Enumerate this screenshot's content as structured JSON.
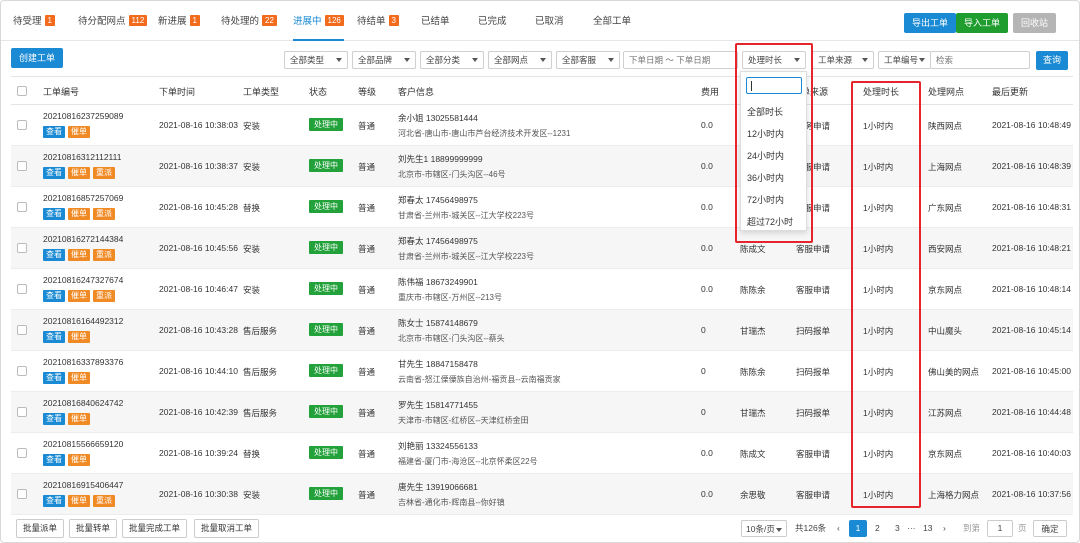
{
  "tabs": [
    {
      "label": "待受理",
      "count": "1"
    },
    {
      "label": "待分配网点",
      "count": "112"
    },
    {
      "label": "新进展",
      "count": "1"
    },
    {
      "label": "待处理的",
      "count": "22"
    },
    {
      "label": "进展中",
      "count": "126",
      "active": true
    },
    {
      "label": "待结单",
      "count": "3"
    },
    {
      "label": "已结单",
      "count": ""
    },
    {
      "label": "已完成",
      "count": ""
    },
    {
      "label": "已取消",
      "count": ""
    },
    {
      "label": "全部工单",
      "count": ""
    }
  ],
  "top_buttons": {
    "export": "导出工单",
    "import": "导入工单",
    "recycle": "回收站"
  },
  "toolbar": {
    "create": "创建工单",
    "filters": [
      "全部类型",
      "全部品牌",
      "全部分类",
      "全部网点",
      "全部客服"
    ],
    "date_placeholder": "下单日期 ～ 下单日期",
    "duration_select": "处理时长",
    "source_select": "工单来源",
    "number_select": "工单编号",
    "search_placeholder": "检索",
    "search_button": "查询"
  },
  "columns": [
    "工单编号",
    "下单时间",
    "工单类型",
    "状态",
    "等级",
    "客户信息",
    "费用",
    "",
    "单来源",
    "处理时长",
    "处理网点",
    "最后更新"
  ],
  "actions": {
    "view": "查看",
    "urge": "催单",
    "reassign": "重派"
  },
  "rows": [
    {
      "id": "20210816237259089",
      "time": "2021-08-16 10:38:03",
      "type": "安装",
      "status": "处理中",
      "level": "普通",
      "customer": "余小姐 13025581444",
      "address": "河北省-唐山市-唐山市芦台经济技术开发区--1231",
      "fee": "0.0",
      "tech": "",
      "source": "服务申请",
      "duration": "1小时内",
      "outlet": "陕西网点",
      "updated": "2021-08-16 10:48:49",
      "btns": [
        "view",
        "urge"
      ]
    },
    {
      "id": "20210816312112111",
      "time": "2021-08-16 10:38:37",
      "type": "安装",
      "status": "处理中",
      "level": "普通",
      "customer": "刘先生1 18899999999",
      "address": "北京市-市辖区-门头沟区--46号",
      "fee": "0.0",
      "tech": "",
      "source": "客服申请",
      "duration": "1小时内",
      "outlet": "上海网点",
      "updated": "2021-08-16 10:48:39",
      "btns": [
        "view",
        "urge",
        "reassign"
      ]
    },
    {
      "id": "20210816857257069",
      "time": "2021-08-16 10:45:28",
      "type": "替换",
      "status": "处理中",
      "level": "普通",
      "customer": "郑春太 17456498975",
      "address": "甘肃省-兰州市-城关区--江大学校223号",
      "fee": "0.0",
      "tech": "",
      "source": "客服申请",
      "duration": "1小时内",
      "outlet": "广东网点",
      "updated": "2021-08-16 10:48:31",
      "btns": [
        "view",
        "urge",
        "reassign"
      ]
    },
    {
      "id": "20210816272144384",
      "time": "2021-08-16 10:45:56",
      "type": "安装",
      "status": "处理中",
      "level": "普通",
      "customer": "郑春太 17456498975",
      "address": "甘肃省-兰州市-城关区--江大学校223号",
      "fee": "0.0",
      "tech": "陈成文",
      "source": "客服申请",
      "duration": "1小时内",
      "outlet": "西安网点",
      "updated": "2021-08-16 10:48:21",
      "btns": [
        "view",
        "urge",
        "reassign"
      ]
    },
    {
      "id": "20210816247327674",
      "time": "2021-08-16 10:46:47",
      "type": "安装",
      "status": "处理中",
      "level": "普通",
      "customer": "陈伟福 18673249901",
      "address": "重庆市-市辖区-万州区--213号",
      "fee": "0.0",
      "tech": "陈陈余",
      "source": "客服申请",
      "duration": "1小时内",
      "outlet": "京东网点",
      "updated": "2021-08-16 10:48:14",
      "btns": [
        "view",
        "urge",
        "reassign"
      ]
    },
    {
      "id": "20210816164492312",
      "time": "2021-08-16 10:43:28",
      "type": "售后服务",
      "status": "处理中",
      "level": "普通",
      "customer": "陈女士 15874148679",
      "address": "北京市-市辖区-门头沟区--蔡头",
      "fee": "0",
      "tech": "甘瑞杰",
      "source": "扫码报单",
      "duration": "1小时内",
      "outlet": "中山魔头",
      "updated": "2021-08-16 10:45:14",
      "btns": [
        "view",
        "urge"
      ]
    },
    {
      "id": "20210816337893376",
      "time": "2021-08-16 10:44:10",
      "type": "售后服务",
      "status": "处理中",
      "level": "普通",
      "customer": "甘先生 18847158478",
      "address": "云南省-怒江傈僳族自治州-福贡县--云南福贡家",
      "fee": "0",
      "tech": "陈陈余",
      "source": "扫码报单",
      "duration": "1小时内",
      "outlet": "佛山美的网点",
      "updated": "2021-08-16 10:45:00",
      "btns": [
        "view",
        "urge"
      ]
    },
    {
      "id": "20210816840624742",
      "time": "2021-08-16 10:42:39",
      "type": "售后服务",
      "status": "处理中",
      "level": "普通",
      "customer": "罗先生 15814771455",
      "address": "天津市-市辖区-红桥区--天津红桥金田",
      "fee": "0",
      "tech": "甘瑞杰",
      "source": "扫码报单",
      "duration": "1小时内",
      "outlet": "江苏网点",
      "updated": "2021-08-16 10:44:48",
      "btns": [
        "view",
        "urge"
      ]
    },
    {
      "id": "20210815566659120",
      "time": "2021-08-16 10:39:24",
      "type": "替换",
      "status": "处理中",
      "level": "普通",
      "customer": "刘艳丽 13324556133",
      "address": "福建省-厦门市-海沧区--北京怀柔区22号",
      "fee": "0.0",
      "tech": "陈成文",
      "source": "客服申请",
      "duration": "1小时内",
      "outlet": "京东网点",
      "updated": "2021-08-16 10:40:03",
      "btns": [
        "view",
        "urge"
      ]
    },
    {
      "id": "20210816915406447",
      "time": "2021-08-16 10:30:38",
      "type": "安装",
      "status": "处理中",
      "level": "普通",
      "customer": "唐先生 13919066681",
      "address": "吉林省-通化市-辉南县--你好镇",
      "fee": "0.0",
      "tech": "余思敬",
      "source": "客服申请",
      "duration": "1小时内",
      "outlet": "上海格力网点",
      "updated": "2021-08-16 10:37:56",
      "btns": [
        "view",
        "urge",
        "reassign"
      ]
    }
  ],
  "duration_options": [
    "全部时长",
    "12小时内",
    "24小时内",
    "36小时内",
    "72小时内",
    "超过72小时"
  ],
  "footer": {
    "batch": [
      "批量派单",
      "批量转单",
      "批量完成工单",
      "批量取消工单"
    ],
    "page_size": "10条/页",
    "total": "共126条",
    "pages": [
      "1",
      "2",
      "3",
      "···",
      "13"
    ],
    "goto": "到第",
    "goto_value": "1",
    "page_unit": "页",
    "confirm": "确定"
  },
  "colors": {
    "accent": "#1a8ad4",
    "green": "#1f9e2f",
    "orange": "#f08a24",
    "badge": "#f26b1d",
    "highlight": "#e5242b"
  }
}
